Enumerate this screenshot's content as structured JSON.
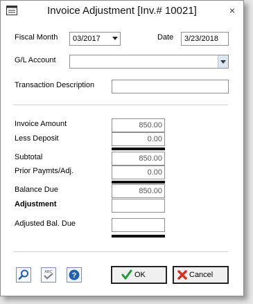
{
  "window": {
    "title": "Invoice Adjustment [Inv.# 10021]",
    "close_glyph": "×"
  },
  "form": {
    "fiscal_month_label": "Fiscal Month",
    "fiscal_month_value": "03/2017",
    "date_label": "Date",
    "date_value": "3/23/2018",
    "gl_account_label": "G/L Account",
    "gl_account_value": "",
    "transaction_description_label": "Transaction Description",
    "transaction_description_value": ""
  },
  "amounts": {
    "invoice_amount_label": "Invoice Amount",
    "invoice_amount_value": "850.00",
    "less_deposit_label": "Less Deposit",
    "less_deposit_value": "0.00",
    "subtotal_label": "Subtotal",
    "subtotal_value": "850.00",
    "prior_payments_label": "Prior Paymts/Adj.",
    "prior_payments_value": "0.00",
    "balance_due_label": "Balance Due",
    "balance_due_value": "850.00",
    "adjustment_label": "Adjustment",
    "adjustment_value": "",
    "adjusted_balance_label": "Adjusted Bal. Due",
    "adjusted_balance_value": ""
  },
  "toolbar": {
    "icons": [
      "search-icon",
      "spellcheck-icon",
      "help-icon"
    ],
    "spellcheck_caption": "ABC",
    "help_glyph": "?"
  },
  "buttons": {
    "ok_label": "OK",
    "cancel_label": "Cancel"
  },
  "colors": {
    "accent_blue": "#1f5fb4",
    "ok_green": "#1a9a3a",
    "cancel_red": "#d83020"
  }
}
